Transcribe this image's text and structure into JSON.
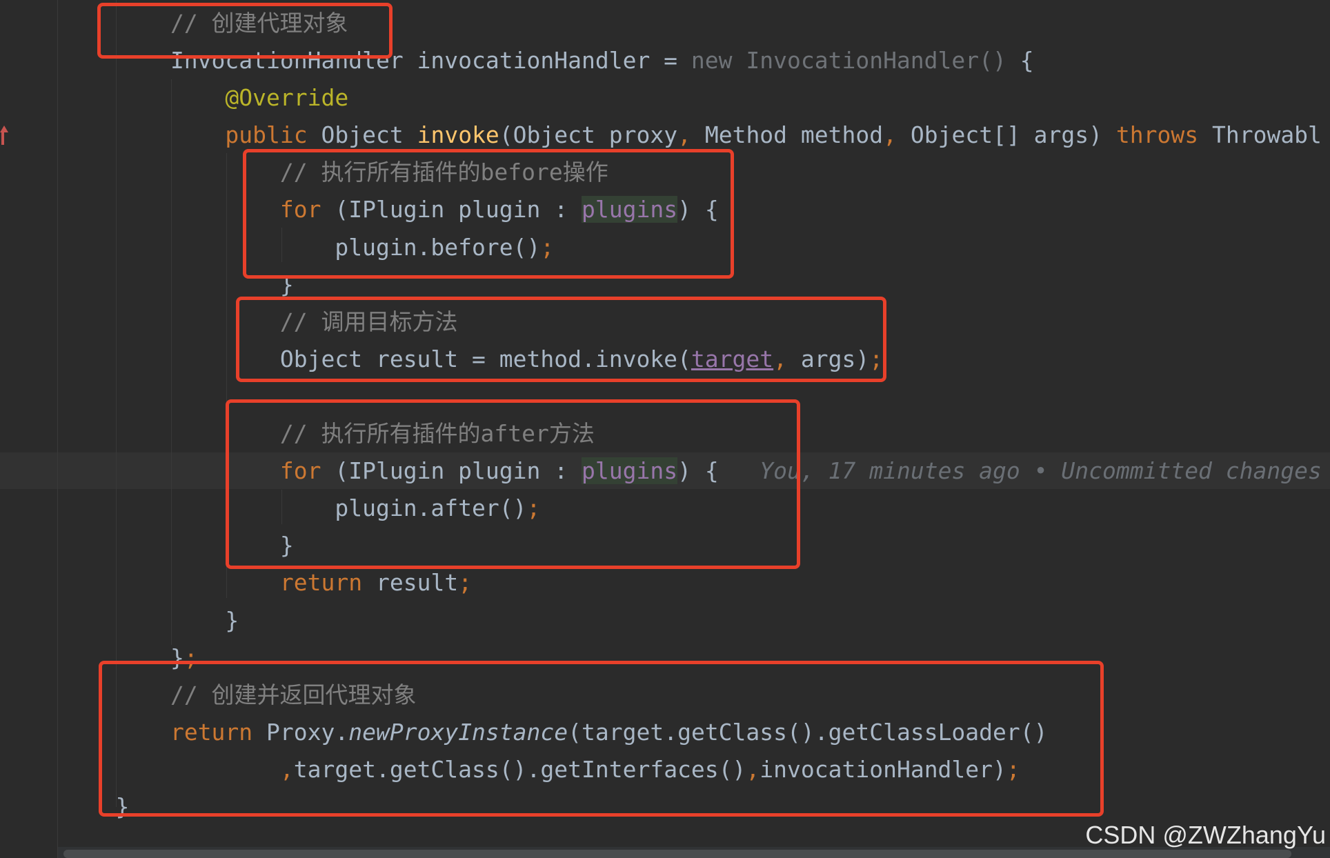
{
  "editor": {
    "colors": {
      "background": "#2b2b2b",
      "keyword": "#cc7832",
      "comment": "#808080",
      "annotation": "#bbb529",
      "method": "#ffc66d",
      "field": "#9876aa",
      "text": "#a9b7c6",
      "highlight_box": "#e8402a"
    },
    "current_line": 12,
    "lines": [
      [
        {
          "t": "        "
        },
        {
          "t": "// 创建代理对象",
          "k": "comment"
        }
      ],
      [
        {
          "t": "        InvocationHandler invocationHandler = "
        },
        {
          "t": "new InvocationHandler()",
          "k": "dim"
        },
        {
          "t": " {"
        }
      ],
      [
        {
          "t": "            "
        },
        {
          "t": "@Override",
          "k": "annotation"
        }
      ],
      [
        {
          "t": "            "
        },
        {
          "t": "public",
          "k": "kw"
        },
        {
          "t": " Object "
        },
        {
          "t": "invoke",
          "k": "method"
        },
        {
          "t": "(Object proxy"
        },
        {
          "t": ",",
          "k": "kw"
        },
        {
          "t": " Method method"
        },
        {
          "t": ",",
          "k": "kw"
        },
        {
          "t": " Object[] args) "
        },
        {
          "t": "throws",
          "k": "kw"
        },
        {
          "t": " Throwabl"
        }
      ],
      [
        {
          "t": "                "
        },
        {
          "t": "// 执行所有插件的before操作",
          "k": "comment"
        }
      ],
      [
        {
          "t": "                "
        },
        {
          "t": "for",
          "k": "kw"
        },
        {
          "t": " (IPlugin plugin : "
        },
        {
          "t": "plugins",
          "k": "field-hl"
        },
        {
          "t": ") {"
        }
      ],
      [
        {
          "t": "                    plugin.before()"
        },
        {
          "t": ";",
          "k": "kw"
        }
      ],
      [
        {
          "t": "                }"
        }
      ],
      [
        {
          "t": "                "
        },
        {
          "t": "// 调用目标方法",
          "k": "comment"
        }
      ],
      [
        {
          "t": "                Object result = method.invoke("
        },
        {
          "t": "target",
          "k": "field-ul"
        },
        {
          "t": ",",
          "k": "kw"
        },
        {
          "t": " args)"
        },
        {
          "t": ";",
          "k": "kw"
        }
      ],
      [
        {
          "t": ""
        }
      ],
      [
        {
          "t": "                "
        },
        {
          "t": "// 执行所有插件的after方法",
          "k": "comment"
        }
      ],
      [
        {
          "t": "                "
        },
        {
          "t": "for",
          "k": "kw"
        },
        {
          "t": " (IPlugin plugin : "
        },
        {
          "t": "plugins",
          "k": "field-hl"
        },
        {
          "t": ") {"
        },
        {
          "t": "   You, 17 minutes ago • Uncommitted changes",
          "k": "blame"
        }
      ],
      [
        {
          "t": "                    plugin.after()"
        },
        {
          "t": ";",
          "k": "kw"
        }
      ],
      [
        {
          "t": "                }"
        }
      ],
      [
        {
          "t": "                "
        },
        {
          "t": "return",
          "k": "kw"
        },
        {
          "t": " result"
        },
        {
          "t": ";",
          "k": "kw"
        }
      ],
      [
        {
          "t": "            }"
        }
      ],
      [
        {
          "t": "        }"
        },
        {
          "t": ";",
          "k": "kw"
        }
      ],
      [
        {
          "t": "        "
        },
        {
          "t": "// 创建并返回代理对象",
          "k": "comment"
        }
      ],
      [
        {
          "t": "        "
        },
        {
          "t": "return",
          "k": "kw"
        },
        {
          "t": " Proxy."
        },
        {
          "t": "newProxyInstance",
          "k": "static"
        },
        {
          "t": "(target.getClass().getClassLoader()"
        }
      ],
      [
        {
          "t": "                "
        },
        {
          "t": ",",
          "k": "kw"
        },
        {
          "t": "target.getClass().getInterfaces()"
        },
        {
          "t": ",",
          "k": "kw"
        },
        {
          "t": "invocationHandler)"
        },
        {
          "t": ";",
          "k": "kw"
        }
      ],
      [
        {
          "t": "    }"
        }
      ]
    ]
  },
  "watermark": "CSDN @ZWZhangYu"
}
